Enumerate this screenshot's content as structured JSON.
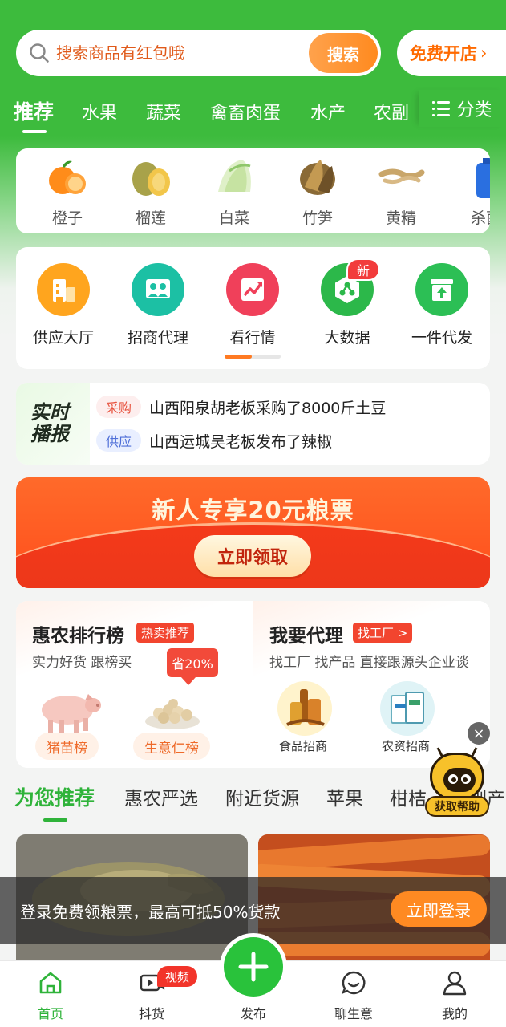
{
  "search": {
    "placeholder": "搜索商品有红包哦",
    "button_label": "搜索",
    "open_shop_label": "免费开店",
    "open_shop_chevron": "›"
  },
  "category_tabs": {
    "items": [
      "推荐",
      "水果",
      "蔬菜",
      "禽畜肉蛋",
      "水产",
      "农副"
    ],
    "active": "推荐",
    "classify_label": "分类"
  },
  "products": [
    {
      "label": "橙子",
      "icon": "orange-icon"
    },
    {
      "label": "榴莲",
      "icon": "durian-icon"
    },
    {
      "label": "白菜",
      "icon": "cabbage-icon"
    },
    {
      "label": "竹笋",
      "icon": "bamboo-shoot-icon"
    },
    {
      "label": "黄精",
      "icon": "huangjing-root-icon"
    },
    {
      "label": "杀菌",
      "icon": "bottle-icon"
    }
  ],
  "features": [
    {
      "label": "供应大厅",
      "icon": "building-icon",
      "color": "#ffa51e"
    },
    {
      "label": "招商代理",
      "icon": "people-icon",
      "color": "#1cc0a4"
    },
    {
      "label": "看行情",
      "icon": "trend-chart-icon",
      "color": "#f0405a"
    },
    {
      "label": "大数据",
      "icon": "data-network-icon",
      "color": "#2cb84a"
    },
    {
      "label": "一件代发",
      "icon": "box-upload-icon",
      "color": "#2cbf55"
    }
  ],
  "new_badge": "新",
  "broadcast": {
    "logo_line1": "实时",
    "logo_line2": "播报",
    "items": [
      {
        "tag": "采购",
        "text": "山西阳泉胡老板采购了8000斤土豆"
      },
      {
        "tag": "供应",
        "text": "山西运城吴老板发布了辣椒"
      }
    ]
  },
  "coupon": {
    "title": "新人专享20元粮票",
    "button_label": "立即领取"
  },
  "rank": {
    "title": "惠农排行榜",
    "tag": "热卖推荐",
    "subtitle": "实力好货 跟榜买",
    "save_badge": "省20%",
    "pills": [
      "猪苗榜",
      "生意仁榜"
    ]
  },
  "agent": {
    "title": "我要代理",
    "tag": "找工厂 >",
    "subtitle": "找工厂 找产品 直接跟源头企业谈",
    "items": [
      "食品招商",
      "农资招商"
    ]
  },
  "recommend_tabs": {
    "items": [
      "为您推荐",
      "惠农严选",
      "附近货源",
      "苹果",
      "柑桔",
      "副产"
    ],
    "active": "为您推荐"
  },
  "helper": {
    "label": "获取帮助",
    "close": "×"
  },
  "login_banner": {
    "text": "登录免费领粮票，最高可抵50%货款",
    "button_label": "立即登录"
  },
  "bottom_nav": {
    "items": [
      {
        "label": "首页",
        "icon": "home-icon",
        "active": true
      },
      {
        "label": "抖货",
        "icon": "video-play-icon",
        "active": false
      },
      {
        "label": "发布",
        "icon": "plus-icon",
        "active": false
      },
      {
        "label": "聊生意",
        "icon": "chat-smile-icon",
        "active": false
      },
      {
        "label": "我的",
        "icon": "user-icon",
        "active": false
      }
    ],
    "video_badge": "视频"
  },
  "colors": {
    "brand_green": "#3dbb3d",
    "accent_orange": "#ff8a1f",
    "coupon_red": "#f43a1a"
  }
}
